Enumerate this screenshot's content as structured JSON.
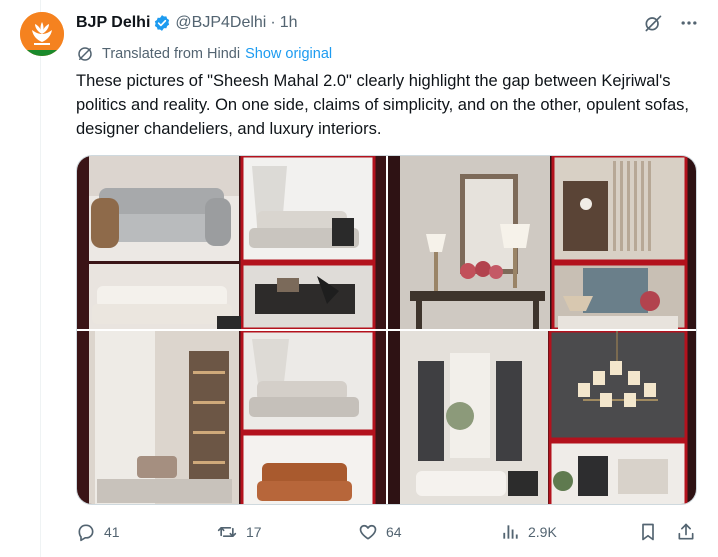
{
  "author": {
    "name": "BJP Delhi",
    "handle": "@BJP4Delhi",
    "separator": "·",
    "time": "1h"
  },
  "translation": {
    "note": "Translated from Hindi",
    "show_original": "Show original"
  },
  "tweet": {
    "text": "These pictures of \"Sheesh Mahal 2.0\" clearly highlight the gap between Kejriwal's politics and reality. On one side, claims of simplicity, and on the other, opulent sofas, designer chandeliers, and luxury interiors."
  },
  "stats": {
    "replies": "41",
    "reposts": "17",
    "likes": "64",
    "views": "2.9K"
  },
  "colors": {
    "accent": "#1d9bf0",
    "muted": "#536471",
    "brand_orange": "#f5821f",
    "collage_red": "#b3121d"
  },
  "icons": [
    "verified-badge-icon",
    "grok-icon",
    "more-icon",
    "translate-icon",
    "reply-icon",
    "repost-icon",
    "like-icon",
    "views-icon",
    "bookmark-icon",
    "share-icon"
  ]
}
